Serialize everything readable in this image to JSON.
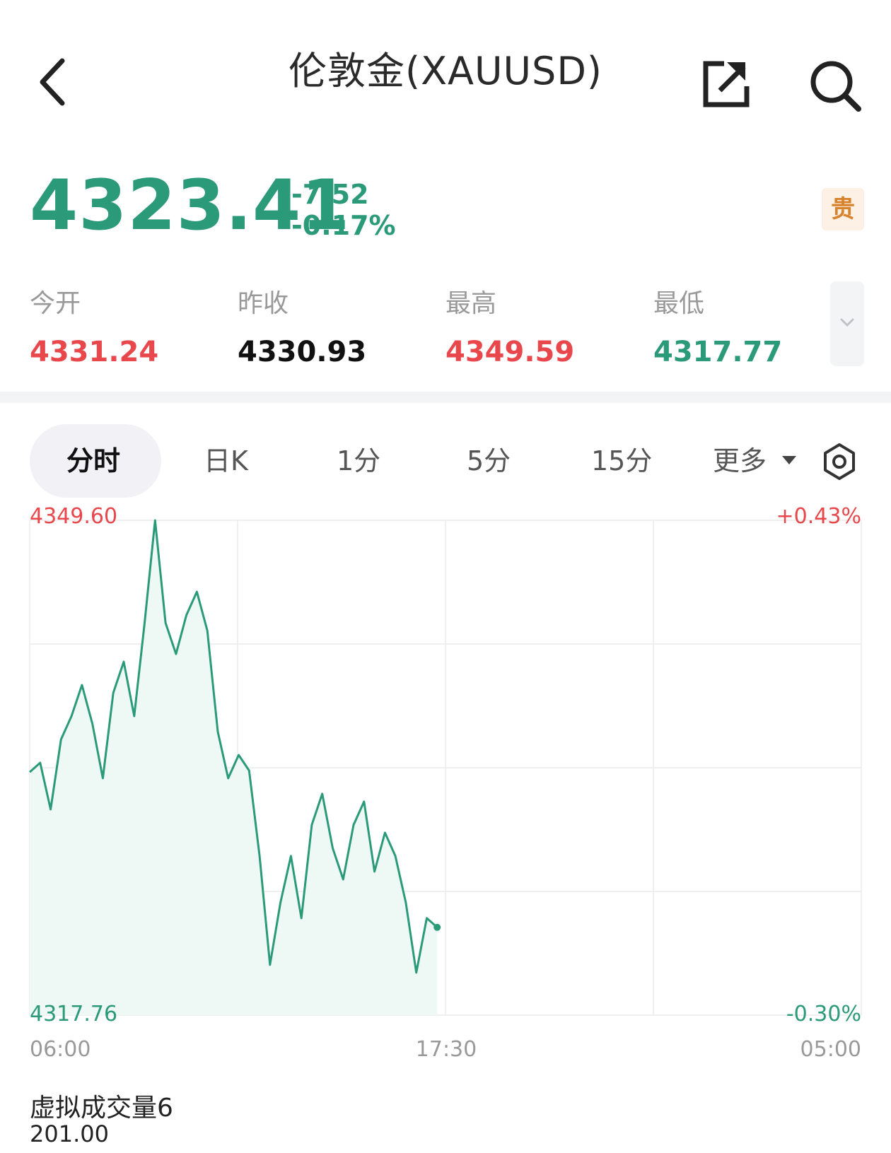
{
  "header": {
    "title": "伦敦金(XAUUSD)",
    "back_icon": "chevron-left-icon",
    "share_icon": "share-external-icon",
    "search_icon": "search-icon"
  },
  "quote": {
    "price": "4323.41",
    "change": "-7.52",
    "change_pct": "-0.17%",
    "badge": "贵",
    "color_down": "#2b9a79",
    "color_up": "#e8474c"
  },
  "stats": [
    {
      "label": "今开",
      "value": "4331.24",
      "trend": "up"
    },
    {
      "label": "昨收",
      "value": "4330.93",
      "trend": "flat"
    },
    {
      "label": "最高",
      "value": "4349.59",
      "trend": "up"
    },
    {
      "label": "最低",
      "value": "4317.77",
      "trend": "down"
    }
  ],
  "tabs": {
    "items": [
      "分时",
      "日K",
      "1分",
      "5分",
      "15分"
    ],
    "active": 0,
    "more": "更多",
    "settings_icon": "gear-icon"
  },
  "chart_data": {
    "type": "area",
    "y_max_label": "4349.60",
    "y_min_label": "4317.76",
    "pct_max_label": "+0.43%",
    "pct_min_label": "-0.30%",
    "ylim": [
      4317.76,
      4349.6
    ],
    "x_tick_labels": [
      "06:00",
      "17:30",
      "05:00"
    ],
    "session_fraction_elapsed": 0.49,
    "grid": true,
    "series": [
      {
        "values": [
          4333.4,
          4334.0,
          4331.0,
          4335.5,
          4337.0,
          4339.0,
          4336.5,
          4333.0,
          4338.5,
          4340.5,
          4337.0,
          4343.0,
          4349.6,
          4343.0,
          4341.0,
          4343.5,
          4345.0,
          4342.5,
          4336.0,
          4333.0,
          4334.5,
          4333.5,
          4328.0,
          4321.0,
          4325.0,
          4328.0,
          4324.0,
          4330.0,
          4332.0,
          4328.5,
          4326.5,
          4330.0,
          4331.5,
          4327.0,
          4329.5,
          4328.0,
          4325.0,
          4320.5,
          4324.0,
          4323.41
        ]
      }
    ]
  },
  "volume": {
    "label": "虚拟成交量6",
    "value": "201.00"
  }
}
